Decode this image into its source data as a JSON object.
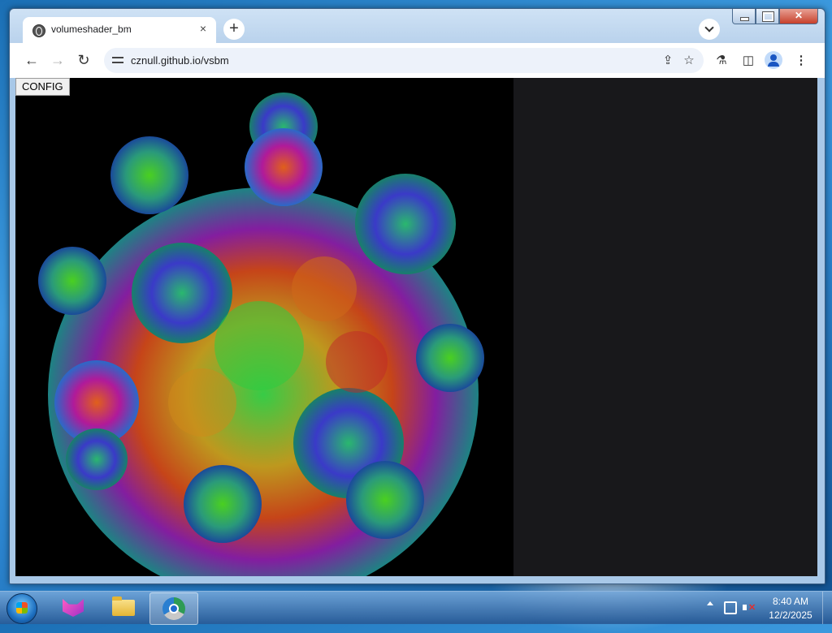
{
  "tab": {
    "title": "volumeshader_bm",
    "close_icon": "×"
  },
  "newtab_icon": "+",
  "nav": {
    "back": "←",
    "forward": "→",
    "reload": "↻"
  },
  "omnibox": {
    "url": "cznull.github.io/vsbm",
    "share_icon": "⇪",
    "bookmark_icon": "☆"
  },
  "toolbar_icons": {
    "labs": "⚗",
    "sidepanel": "◫",
    "menu": "⋮"
  },
  "page": {
    "config_label": "CONFIG"
  },
  "taskbar": {
    "time": "8:40 AM",
    "date": "12/2/2025"
  },
  "colors": {
    "fractal_bg": "#000000",
    "panel_bg": "#18181b"
  }
}
